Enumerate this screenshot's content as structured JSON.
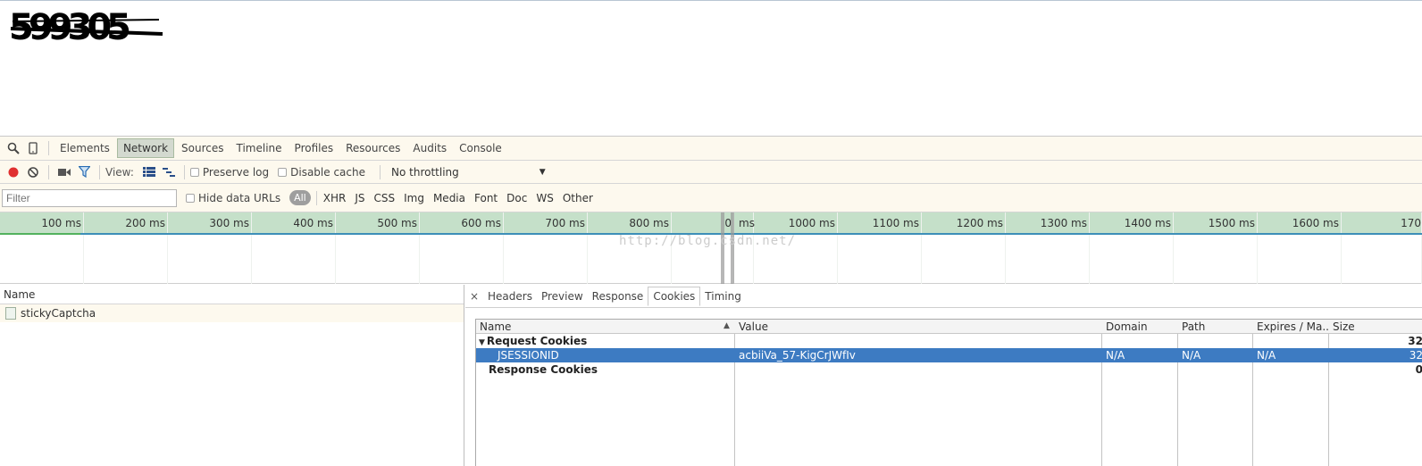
{
  "captcha_text": "599305",
  "devtools": {
    "tabs": [
      "Elements",
      "Network",
      "Sources",
      "Timeline",
      "Profiles",
      "Resources",
      "Audits",
      "Console"
    ],
    "active_tab": "Network",
    "view_label": "View:",
    "preserve_log": "Preserve log",
    "disable_cache": "Disable cache",
    "throttling": "No throttling",
    "filter_placeholder": "Filter",
    "hide_data_urls": "Hide data URLs",
    "types": [
      "All",
      "XHR",
      "JS",
      "CSS",
      "Img",
      "Media",
      "Font",
      "Doc",
      "WS",
      "Other"
    ],
    "timeline_ticks": [
      "100 ms",
      "200 ms",
      "300 ms",
      "400 ms",
      "500 ms",
      "600 ms",
      "700 ms",
      "800 ms",
      "0",
      "ms",
      "1000 ms",
      "1100 ms",
      "1200 ms",
      "1300 ms",
      "1400 ms",
      "1500 ms",
      "1600 ms",
      "170"
    ],
    "watermark": "http://blog.csdn.net/",
    "name_header": "Name",
    "requests": [
      "stickyCaptcha"
    ],
    "detail_tabs": [
      "Headers",
      "Preview",
      "Response",
      "Cookies",
      "Timing"
    ],
    "active_detail_tab": "Cookies",
    "close": "×",
    "cookie_columns": [
      "Name",
      "Value",
      "Domain",
      "Path",
      "Expires / Ma...",
      "Size"
    ],
    "cookie_rows": {
      "request_group": {
        "name": "Request Cookies",
        "size": "32"
      },
      "jsessionid": {
        "name": "JSESSIONID",
        "value": "acbiiVa_57-KigCrJWfIv",
        "domain": "N/A",
        "path": "N/A",
        "expires": "N/A",
        "size": "32"
      },
      "response_group": {
        "name": "Response Cookies",
        "size": "0"
      }
    }
  },
  "colors": {
    "record": "#e03030",
    "ruler": "#c5e0c9",
    "selection": "#3d7bc2",
    "toolbar_bg": "#fdf9ee"
  }
}
